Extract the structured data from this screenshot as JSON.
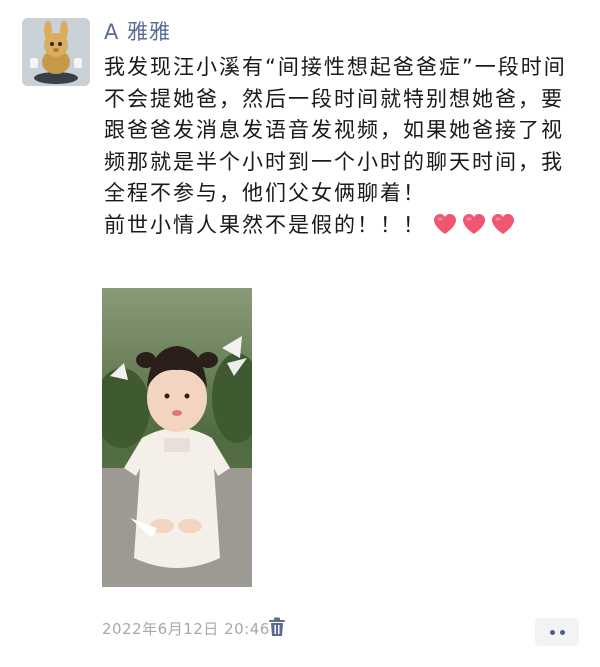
{
  "post": {
    "author_name": "A  雅雅",
    "paragraphs": [
      "我发现汪小溪有“间接性想起爸爸症”一段时间不会提她爸，然后一段时间就特别想她爸，要跟爸爸发消息发语音发视频，如果她爸接了视频那就是半个小时到一个小时的聊天时间，我全程不参与，他们父女俩聊着！",
      "前世小情人果然不是假的！！！"
    ],
    "emoji": [
      "heart-icon",
      "heart-icon",
      "heart-icon"
    ],
    "timestamp": "2022年6月12日 20:46"
  },
  "colors": {
    "name": "#576b95",
    "text": "#1a1a1a",
    "timestamp": "#a8a8a8",
    "heart": "#f0566f",
    "more_button_bg": "#f2f3f5"
  }
}
